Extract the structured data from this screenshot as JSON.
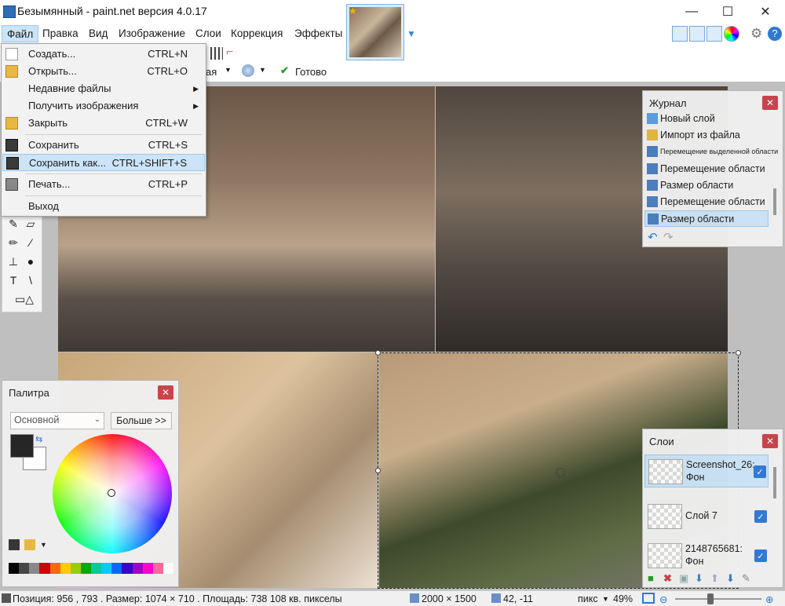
{
  "window": {
    "title": "Безымянный - paint.net версия 4.0.17"
  },
  "menubar": {
    "items": [
      "Файл",
      "Правка",
      "Вид",
      "Изображение",
      "Слои",
      "Коррекция",
      "Эффекты"
    ]
  },
  "file_menu": {
    "items": [
      {
        "label": "Создать...",
        "shortcut": "CTRL+N",
        "icon": "new-file-icon"
      },
      {
        "label": "Открыть...",
        "shortcut": "CTRL+O",
        "icon": "open-folder-icon"
      },
      {
        "label": "Недавние файлы",
        "shortcut": "",
        "icon": "",
        "submenu": true
      },
      {
        "label": "Получить изображения",
        "shortcut": "",
        "icon": "",
        "submenu": true
      },
      {
        "label": "Закрыть",
        "shortcut": "CTRL+W",
        "icon": "close-file-icon"
      },
      {
        "label": "Сохранить",
        "shortcut": "CTRL+S",
        "icon": "save-icon"
      },
      {
        "label": "Сохранить как...",
        "shortcut": "CTRL+SHIFT+S",
        "icon": "save-as-icon",
        "highlighted": true
      },
      {
        "label": "Печать...",
        "shortcut": "CTRL+P",
        "icon": "print-icon"
      },
      {
        "label": "Выход",
        "shortcut": "",
        "icon": ""
      }
    ]
  },
  "toolbar": {
    "partial_label": "ая",
    "done_label": "Готово"
  },
  "history_panel": {
    "title": "Журнал",
    "items": [
      {
        "label": "Новый слой",
        "icon": "new-layer-icon"
      },
      {
        "label": "Импорт из файла",
        "icon": "import-icon"
      },
      {
        "label": "Перемещение выделенной области",
        "icon": "move-selection-icon",
        "small": true
      },
      {
        "label": "Перемещение области",
        "icon": "move-icon"
      },
      {
        "label": "Размер области",
        "icon": "resize-icon"
      },
      {
        "label": "Перемещение области",
        "icon": "move-icon"
      },
      {
        "label": "Размер области",
        "icon": "resize-icon",
        "selected": true
      }
    ]
  },
  "palette_panel": {
    "title": "Палитра",
    "mode": "Основной",
    "more_label": "Больше >>",
    "primary_color": "#222222",
    "secondary_color": "#ffffff"
  },
  "layers_panel": {
    "title": "Слои",
    "layers": [
      {
        "name": "Screenshot_26: Фон",
        "visible": true,
        "selected": true
      },
      {
        "name": "Слой 7",
        "visible": true,
        "selected": false
      },
      {
        "name": "2148765681: Фон",
        "visible": true,
        "selected": false
      }
    ]
  },
  "status": {
    "position": "Позиция: 956 , 793 . Размер: 1074 × 710 . Площадь: 738 108 кв. пикселы",
    "image_size": "2000 × 1500",
    "cursor": "42, -11",
    "unit": "пикс",
    "zoom": "49%"
  },
  "colors": {
    "accent": "#cce4f7",
    "accent_border": "#99c9ef",
    "close_red": "#c9414a"
  }
}
